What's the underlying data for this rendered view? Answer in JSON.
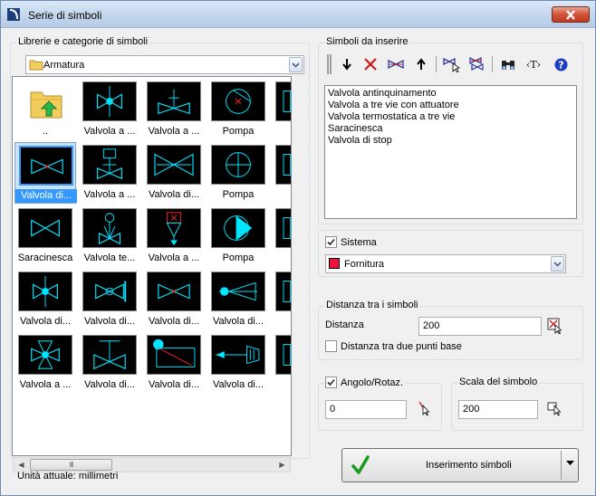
{
  "window": {
    "title": "Serie di simboli"
  },
  "library": {
    "group_label": "Librerie e categorie di simboli",
    "category_value": "Armatura",
    "tiles": [
      {
        "label": "..",
        "type": "folder"
      },
      {
        "label": "Valvola a ...",
        "type": "v_ball"
      },
      {
        "label": "Valvola a ...",
        "type": "v_stem"
      },
      {
        "label": "Pompa",
        "type": "pump_x"
      },
      {
        "label": "Valv",
        "type": "partial"
      },
      {
        "label": "Valvola di...",
        "type": "v_redx",
        "selected": true
      },
      {
        "label": "Valvola a ...",
        "type": "v_actuator"
      },
      {
        "label": "Valvola di...",
        "type": "v_wide"
      },
      {
        "label": "Pompa",
        "type": "pump_v"
      },
      {
        "label": "Valv",
        "type": "partial"
      },
      {
        "label": "Saracinesca",
        "type": "v_plain"
      },
      {
        "label": "Valvola te...",
        "type": "v_thermo"
      },
      {
        "label": "Valvola a ...",
        "type": "v_three"
      },
      {
        "label": "Pompa",
        "type": "pump_fill"
      },
      {
        "label": "Valv",
        "type": "partial"
      },
      {
        "label": "Valvola di...",
        "type": "v_ball"
      },
      {
        "label": "Valvola di...",
        "type": "v_ball_bar"
      },
      {
        "label": "Valvola di...",
        "type": "v_redx"
      },
      {
        "label": "Valvola di...",
        "type": "v_dot"
      },
      {
        "label": "Valv",
        "type": "partial"
      },
      {
        "label": "Valvola a ...",
        "type": "v_four"
      },
      {
        "label": "Valvola di...",
        "type": "v_stem_t"
      },
      {
        "label": "Valvola di...",
        "type": "v_rect"
      },
      {
        "label": "Valvola di...",
        "type": "v_arrow"
      },
      {
        "label": "Scon",
        "type": "partial"
      }
    ],
    "unit_text": "Unità attuale: millimetri"
  },
  "insert": {
    "group_label": "Simboli da inserire",
    "items": [
      "Valvola antinquinamento",
      "Valvola a tre vie con attuatore",
      "Valvola termostatica a tre vie",
      "Saracinesca",
      "Valvola di stop"
    ]
  },
  "sistema": {
    "label": "Sistema",
    "checked": true,
    "value": "Fornitura",
    "color": "#e8143c"
  },
  "distance": {
    "group_label": "Distanza tra i simboli",
    "label": "Distanza",
    "value": "200",
    "two_points_label": "Distanza tra due punti base",
    "two_points_checked": false
  },
  "angle": {
    "label": "Angolo/Rotaz.",
    "checked": true,
    "value": "0"
  },
  "scale": {
    "label": "Scala del simbolo",
    "value": "200"
  },
  "actions": {
    "insert_label": "Inserimento simboli"
  },
  "colors": {
    "symbol_cyan": "#00e5ff",
    "symbol_red": "#ff2020",
    "selection": "#3399ff",
    "check_green": "#1a9a1a"
  }
}
